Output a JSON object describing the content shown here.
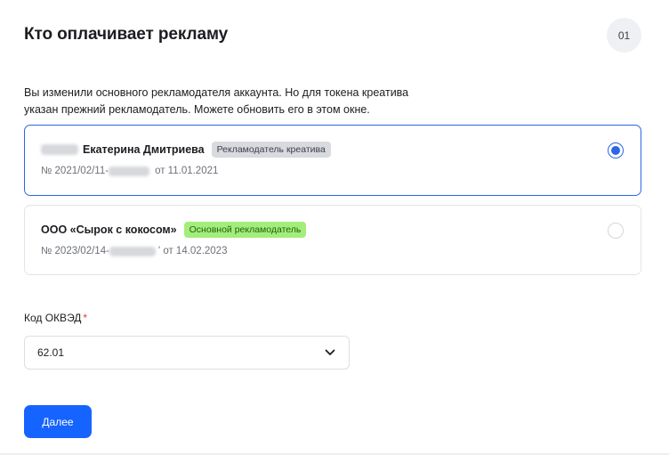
{
  "header": {
    "title": "Кто оплачивает рекламу",
    "step": "01"
  },
  "description": "Вы изменили основного рекламодателя аккаунта. Но для токена креатива указан прежний рекламодатель. Можете обновить его в этом окне.",
  "advertisers": [
    {
      "name": "Екатерина Дмитриева",
      "tag": "Рекламодатель креатива",
      "contract_prefix": "№ 2021/02/11-",
      "contract_date": "от 11.01.2021",
      "selected": true
    },
    {
      "name": "ООО «Сырок с кокосом»",
      "tag": "Основной рекламодатель",
      "contract_prefix": "№ 2023/02/14-",
      "contract_date": "' от 14.02.2023",
      "selected": false
    }
  ],
  "okved": {
    "label": "Код ОКВЭД",
    "required_mark": "*",
    "value": "62.01"
  },
  "actions": {
    "next_label": "Далее"
  },
  "colors": {
    "accent": "#1664ff",
    "selected_border": "#2c66e6",
    "tag_green": "#a3ee7a",
    "tag_gray": "#d8dadf",
    "required": "#e2362f"
  }
}
